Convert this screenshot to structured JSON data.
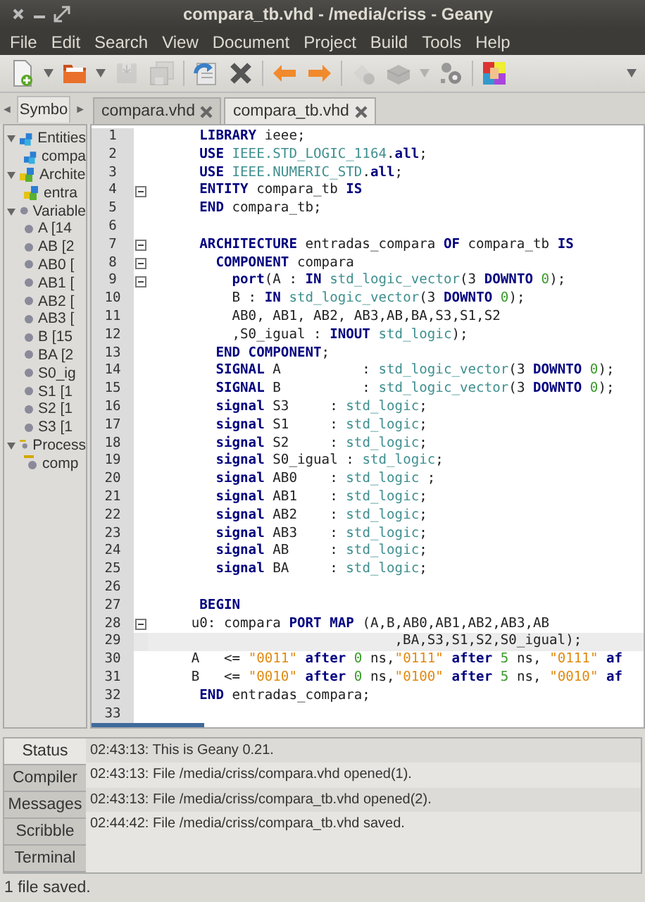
{
  "window": {
    "title": "compara_tb.vhd - /media/criss - Geany"
  },
  "menu": [
    "File",
    "Edit",
    "Search",
    "View",
    "Document",
    "Project",
    "Build",
    "Tools",
    "Help"
  ],
  "toolbar": [
    {
      "kind": "new",
      "disabled": false
    },
    {
      "kind": "caret",
      "disabled": false
    },
    {
      "kind": "open",
      "disabled": false
    },
    {
      "kind": "caret",
      "disabled": false
    },
    {
      "kind": "save",
      "disabled": true
    },
    {
      "kind": "saveall",
      "disabled": true
    },
    {
      "kind": "sep"
    },
    {
      "kind": "reload",
      "disabled": false
    },
    {
      "kind": "close",
      "disabled": false
    },
    {
      "kind": "sep"
    },
    {
      "kind": "back",
      "disabled": false
    },
    {
      "kind": "forward",
      "disabled": false
    },
    {
      "kind": "sep"
    },
    {
      "kind": "compile",
      "disabled": true
    },
    {
      "kind": "build",
      "disabled": true
    },
    {
      "kind": "caret",
      "disabled": true
    },
    {
      "kind": "run",
      "disabled": false
    },
    {
      "kind": "sep"
    },
    {
      "kind": "color",
      "disabled": false
    },
    {
      "kind": "spacer"
    },
    {
      "kind": "caret",
      "disabled": false
    }
  ],
  "sidebar": {
    "prev": "◄",
    "tab": "Symbo",
    "next": "►",
    "tree": [
      {
        "label": "Entities",
        "kind": "entity",
        "expanded": true,
        "children": [
          {
            "label": "compa",
            "kind": "entity"
          }
        ]
      },
      {
        "label": "Archite",
        "kind": "architecture",
        "expanded": true,
        "children": [
          {
            "label": "entra",
            "kind": "architecture"
          }
        ]
      },
      {
        "label": "Variable",
        "kind": "variable",
        "expanded": true,
        "children": [
          {
            "label": "A [14",
            "kind": "variable"
          },
          {
            "label": "AB [2",
            "kind": "variable"
          },
          {
            "label": "AB0 [",
            "kind": "variable"
          },
          {
            "label": "AB1 [",
            "kind": "variable"
          },
          {
            "label": "AB2 [",
            "kind": "variable"
          },
          {
            "label": "AB3 [",
            "kind": "variable"
          },
          {
            "label": "B [15",
            "kind": "variable"
          },
          {
            "label": "BA [2",
            "kind": "variable"
          },
          {
            "label": "S0_ig",
            "kind": "variable"
          },
          {
            "label": "S1 [1",
            "kind": "variable"
          },
          {
            "label": "S2 [1",
            "kind": "variable"
          },
          {
            "label": "S3 [1",
            "kind": "variable"
          }
        ]
      },
      {
        "label": "Process",
        "kind": "process",
        "expanded": true,
        "children": [
          {
            "label": "comp",
            "kind": "process"
          }
        ]
      }
    ]
  },
  "tabs": [
    {
      "label": "compara.vhd",
      "selected": false
    },
    {
      "label": "compara_tb.vhd",
      "selected": true
    }
  ],
  "editor": {
    "lines": [
      {
        "n": "1",
        "fold": false,
        "current": false,
        "tokens": [
          {
            "kind": "kw",
            "t": "      LIBRARY"
          },
          {
            "kind": "id",
            "t": " ieee;"
          }
        ]
      },
      {
        "n": "2",
        "fold": false,
        "current": false,
        "tokens": [
          {
            "kind": "kw",
            "t": "      USE"
          },
          {
            "kind": "ty",
            "t": " IEEE.STD_LOGIC_1164"
          },
          {
            "kind": "id",
            "t": "."
          },
          {
            "kind": "kw",
            "t": "all"
          },
          {
            "kind": "id",
            "t": ";"
          }
        ]
      },
      {
        "n": "3",
        "fold": false,
        "current": false,
        "tokens": [
          {
            "kind": "kw",
            "t": "      USE"
          },
          {
            "kind": "ty",
            "t": " IEEE.NUMERIC_STD"
          },
          {
            "kind": "id",
            "t": "."
          },
          {
            "kind": "kw",
            "t": "all"
          },
          {
            "kind": "id",
            "t": ";"
          }
        ]
      },
      {
        "n": "4",
        "fold": true,
        "current": false,
        "tokens": [
          {
            "kind": "kw",
            "t": "      ENTITY"
          },
          {
            "kind": "id",
            "t": " compara_tb "
          },
          {
            "kind": "kw",
            "t": "IS"
          }
        ]
      },
      {
        "n": "5",
        "fold": false,
        "current": false,
        "tokens": [
          {
            "kind": "kw",
            "t": "      END"
          },
          {
            "kind": "id",
            "t": " compara_tb;"
          }
        ]
      },
      {
        "n": "6",
        "fold": false,
        "current": false
      },
      {
        "n": "7",
        "fold": true,
        "current": false,
        "tokens": [
          {
            "kind": "kw",
            "t": "      ARCHITECTURE"
          },
          {
            "kind": "id",
            "t": " entradas_compara "
          },
          {
            "kind": "kw",
            "t": "OF"
          },
          {
            "kind": "id",
            "t": " compara_tb "
          },
          {
            "kind": "kw",
            "t": "IS"
          }
        ]
      },
      {
        "n": "8",
        "fold": true,
        "current": false,
        "tokens": [
          {
            "kind": "kw",
            "t": "        COMPONENT"
          },
          {
            "kind": "id",
            "t": " compara"
          }
        ]
      },
      {
        "n": "9",
        "fold": true,
        "current": false,
        "tokens": [
          {
            "kind": "kw",
            "t": "          port"
          },
          {
            "kind": "id",
            "t": "(A : "
          },
          {
            "kind": "kw",
            "t": "IN"
          },
          {
            "kind": "ty",
            "t": " std_logic_vector"
          },
          {
            "kind": "id",
            "t": "(3 "
          },
          {
            "kind": "kw",
            "t": "DOWNTO"
          },
          {
            "kind": "num",
            "t": " 0"
          },
          {
            "kind": "id",
            "t": ");"
          }
        ]
      },
      {
        "n": "10",
        "fold": false,
        "current": false,
        "tokens": [
          {
            "kind": "id",
            "t": "          B : "
          },
          {
            "kind": "kw",
            "t": "IN"
          },
          {
            "kind": "ty",
            "t": " std_logic_vector"
          },
          {
            "kind": "id",
            "t": "(3 "
          },
          {
            "kind": "kw",
            "t": "DOWNTO"
          },
          {
            "kind": "num",
            "t": " 0"
          },
          {
            "kind": "id",
            "t": ");"
          }
        ]
      },
      {
        "n": "11",
        "fold": false,
        "current": false,
        "tokens": [
          {
            "kind": "id",
            "t": "          AB0, AB1, AB2, AB3,AB,BA,S3,S1,S2"
          }
        ]
      },
      {
        "n": "12",
        "fold": false,
        "current": false,
        "tokens": [
          {
            "kind": "id",
            "t": "          ,S0_igual : "
          },
          {
            "kind": "kw",
            "t": "INOUT"
          },
          {
            "kind": "ty",
            "t": " std_logic"
          },
          {
            "kind": "id",
            "t": ");"
          }
        ]
      },
      {
        "n": "13",
        "fold": false,
        "current": false,
        "tokens": [
          {
            "kind": "kw",
            "t": "        END COMPONENT"
          },
          {
            "kind": "id",
            "t": ";"
          }
        ]
      },
      {
        "n": "14",
        "fold": false,
        "current": false,
        "tokens": [
          {
            "kind": "kw",
            "t": "        SIGNAL"
          },
          {
            "kind": "id",
            "t": " A          : "
          },
          {
            "kind": "ty",
            "t": "std_logic_vector"
          },
          {
            "kind": "id",
            "t": "(3 "
          },
          {
            "kind": "kw",
            "t": "DOWNTO"
          },
          {
            "kind": "num",
            "t": " 0"
          },
          {
            "kind": "id",
            "t": ");"
          }
        ]
      },
      {
        "n": "15",
        "fold": false,
        "current": false,
        "tokens": [
          {
            "kind": "kw",
            "t": "        SIGNAL"
          },
          {
            "kind": "id",
            "t": " B          : "
          },
          {
            "kind": "ty",
            "t": "std_logic_vector"
          },
          {
            "kind": "id",
            "t": "(3 "
          },
          {
            "kind": "kw",
            "t": "DOWNTO"
          },
          {
            "kind": "num",
            "t": " 0"
          },
          {
            "kind": "id",
            "t": ");"
          }
        ]
      },
      {
        "n": "16",
        "fold": false,
        "current": false,
        "tokens": [
          {
            "kind": "kw",
            "t": "        signal"
          },
          {
            "kind": "id",
            "t": " S3     : "
          },
          {
            "kind": "ty",
            "t": "std_logic"
          },
          {
            "kind": "id",
            "t": ";"
          }
        ]
      },
      {
        "n": "17",
        "fold": false,
        "current": false,
        "tokens": [
          {
            "kind": "kw",
            "t": "        signal"
          },
          {
            "kind": "id",
            "t": " S1     : "
          },
          {
            "kind": "ty",
            "t": "std_logic"
          },
          {
            "kind": "id",
            "t": ";"
          }
        ]
      },
      {
        "n": "18",
        "fold": false,
        "current": false,
        "tokens": [
          {
            "kind": "kw",
            "t": "        signal"
          },
          {
            "kind": "id",
            "t": " S2     : "
          },
          {
            "kind": "ty",
            "t": "std_logic"
          },
          {
            "kind": "id",
            "t": ";"
          }
        ]
      },
      {
        "n": "19",
        "fold": false,
        "current": false,
        "tokens": [
          {
            "kind": "kw",
            "t": "        signal"
          },
          {
            "kind": "id",
            "t": " S0_igual : "
          },
          {
            "kind": "ty",
            "t": "std_logic"
          },
          {
            "kind": "id",
            "t": ";"
          }
        ]
      },
      {
        "n": "20",
        "fold": false,
        "current": false,
        "tokens": [
          {
            "kind": "kw",
            "t": "        signal"
          },
          {
            "kind": "id",
            "t": " AB0    : "
          },
          {
            "kind": "ty",
            "t": "std_logic"
          },
          {
            "kind": "id",
            "t": " ;"
          }
        ]
      },
      {
        "n": "21",
        "fold": false,
        "current": false,
        "tokens": [
          {
            "kind": "kw",
            "t": "        signal"
          },
          {
            "kind": "id",
            "t": " AB1    : "
          },
          {
            "kind": "ty",
            "t": "std_logic"
          },
          {
            "kind": "id",
            "t": ";"
          }
        ]
      },
      {
        "n": "22",
        "fold": false,
        "current": false,
        "tokens": [
          {
            "kind": "kw",
            "t": "        signal"
          },
          {
            "kind": "id",
            "t": " AB2    : "
          },
          {
            "kind": "ty",
            "t": "std_logic"
          },
          {
            "kind": "id",
            "t": ";"
          }
        ]
      },
      {
        "n": "23",
        "fold": false,
        "current": false,
        "tokens": [
          {
            "kind": "kw",
            "t": "        signal"
          },
          {
            "kind": "id",
            "t": " AB3    : "
          },
          {
            "kind": "ty",
            "t": "std_logic"
          },
          {
            "kind": "id",
            "t": ";"
          }
        ]
      },
      {
        "n": "24",
        "fold": false,
        "current": false,
        "tokens": [
          {
            "kind": "kw",
            "t": "        signal"
          },
          {
            "kind": "id",
            "t": " AB     : "
          },
          {
            "kind": "ty",
            "t": "std_logic"
          },
          {
            "kind": "id",
            "t": ";"
          }
        ]
      },
      {
        "n": "25",
        "fold": false,
        "current": false,
        "tokens": [
          {
            "kind": "kw",
            "t": "        signal"
          },
          {
            "kind": "id",
            "t": " BA     : "
          },
          {
            "kind": "ty",
            "t": "std_logic"
          },
          {
            "kind": "id",
            "t": ";"
          }
        ]
      },
      {
        "n": "26",
        "fold": false,
        "current": false
      },
      {
        "n": "27",
        "fold": false,
        "current": false,
        "tokens": [
          {
            "kind": "kw",
            "t": "      BEGIN"
          }
        ]
      },
      {
        "n": "28",
        "fold": true,
        "current": false,
        "tokens": [
          {
            "kind": "id",
            "t": "     u0: compara "
          },
          {
            "kind": "kw",
            "t": "PORT MAP"
          },
          {
            "kind": "id",
            "t": " (A,B,AB0,AB1,AB2,AB3,AB"
          }
        ]
      },
      {
        "n": "29",
        "fold": false,
        "current": true,
        "tokens": [
          {
            "kind": "id",
            "t": "                              ,BA,S3,S1,S2,S0_igual);"
          }
        ]
      },
      {
        "n": "30",
        "fold": false,
        "current": false,
        "tokens": [
          {
            "kind": "id",
            "t": "     A   <= "
          },
          {
            "kind": "str",
            "t": "\"0011\""
          },
          {
            "kind": "kw",
            "t": " after"
          },
          {
            "kind": "num",
            "t": " 0"
          },
          {
            "kind": "id",
            "t": " ns,"
          },
          {
            "kind": "str",
            "t": "\"0111\""
          },
          {
            "kind": "kw",
            "t": " after"
          },
          {
            "kind": "num",
            "t": " 5"
          },
          {
            "kind": "id",
            "t": " ns, "
          },
          {
            "kind": "str",
            "t": "\"0111\""
          },
          {
            "kind": "kw",
            "t": " af"
          }
        ]
      },
      {
        "n": "31",
        "fold": false,
        "current": false,
        "tokens": [
          {
            "kind": "id",
            "t": "     B   <= "
          },
          {
            "kind": "str",
            "t": "\"0010\""
          },
          {
            "kind": "kw",
            "t": " after"
          },
          {
            "kind": "num",
            "t": " 0"
          },
          {
            "kind": "id",
            "t": " ns,"
          },
          {
            "kind": "str",
            "t": "\"0100\""
          },
          {
            "kind": "kw",
            "t": " after"
          },
          {
            "kind": "num",
            "t": " 5"
          },
          {
            "kind": "id",
            "t": " ns, "
          },
          {
            "kind": "str",
            "t": "\"0010\""
          },
          {
            "kind": "kw",
            "t": " af"
          }
        ]
      },
      {
        "n": "32",
        "fold": false,
        "current": false,
        "tokens": [
          {
            "kind": "kw",
            "t": "      END"
          },
          {
            "kind": "id",
            "t": " entradas_compara;"
          }
        ]
      },
      {
        "n": "33",
        "fold": false,
        "current": false
      }
    ]
  },
  "messages": {
    "tabs": [
      {
        "label": "Status",
        "selected": true
      },
      {
        "label": "Compiler",
        "selected": false
      },
      {
        "label": "Messages",
        "selected": false
      },
      {
        "label": "Scribble",
        "selected": false
      },
      {
        "label": "Terminal",
        "selected": false
      }
    ],
    "entries": [
      "02:43:13: This is Geany 0.21.",
      "02:43:13: File /media/criss/compara.vhd opened(1).",
      "02:43:13: File /media/criss/compara_tb.vhd opened(2).",
      "02:44:42: File /media/criss/compara_tb.vhd saved."
    ]
  },
  "status_bar": "1 file saved."
}
